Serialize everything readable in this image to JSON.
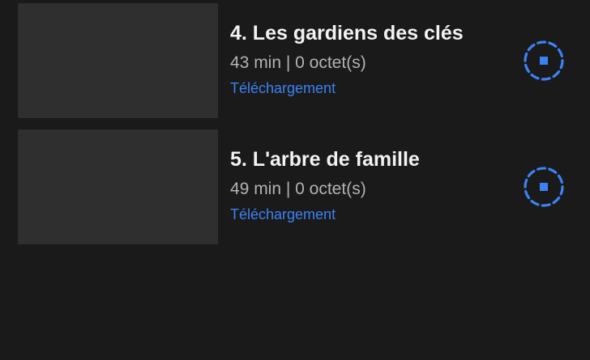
{
  "colors": {
    "background": "#1a1a1a",
    "thumbnail": "#2f2f2f",
    "title": "#f2f2f2",
    "meta": "#b3b3b3",
    "accent": "#3b82f6"
  },
  "episodes": [
    {
      "title": "4. Les gardiens des clés",
      "meta": "43 min | 0 octet(s)",
      "status": "Téléchargement",
      "action_icon": "stop-download-icon"
    },
    {
      "title": "5. L'arbre de famille",
      "meta": "49 min | 0 octet(s)",
      "status": "Téléchargement",
      "action_icon": "stop-download-icon"
    }
  ]
}
